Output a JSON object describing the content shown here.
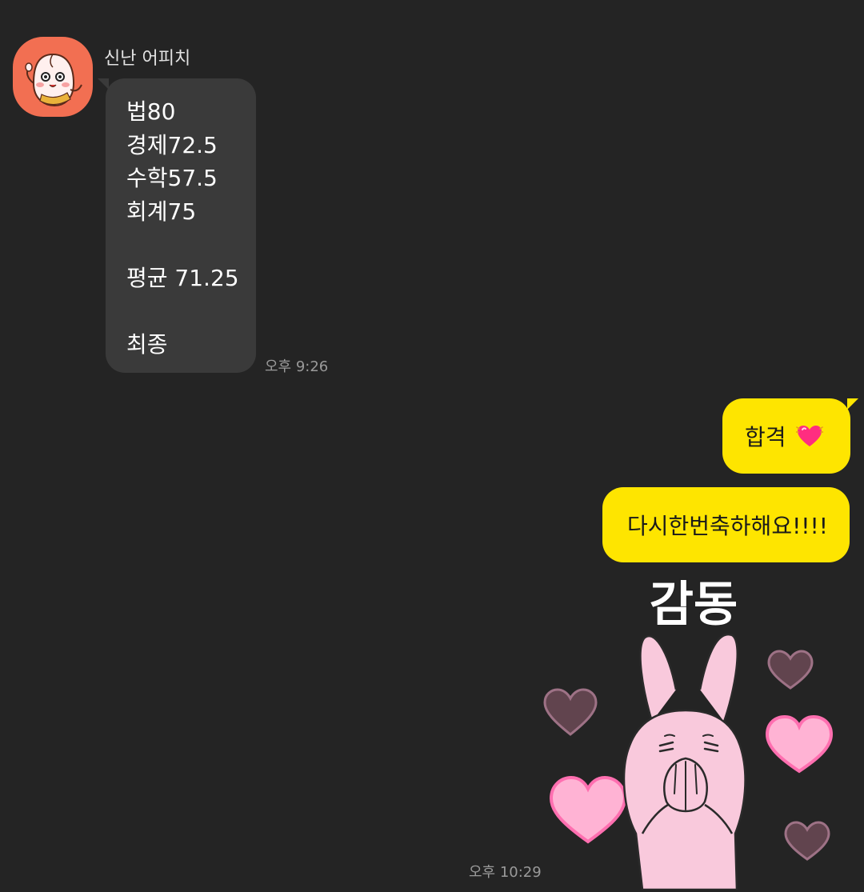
{
  "sender": {
    "name": "신난 어피치",
    "avatar_icon": "apeach-character-icon"
  },
  "incoming": {
    "lines": [
      "법80",
      "경제72.5",
      "수학57.5",
      "회계75",
      "",
      "평균 71.25",
      "",
      "최종"
    ],
    "time": "오후 9:26"
  },
  "outgoing": [
    {
      "text": "합격",
      "emoji": "heart-emoji"
    },
    {
      "text": "다시한번축하해요!!!!"
    }
  ],
  "sticker": {
    "caption": "감동",
    "icon": "pink-rabbit-hearts-sticker"
  },
  "outgoing_time": "오후 10:29",
  "colors": {
    "background": "#242424",
    "incoming_bubble": "#3a3a3a",
    "outgoing_bubble": "#fee500",
    "avatar_bg": "#f26f52"
  }
}
